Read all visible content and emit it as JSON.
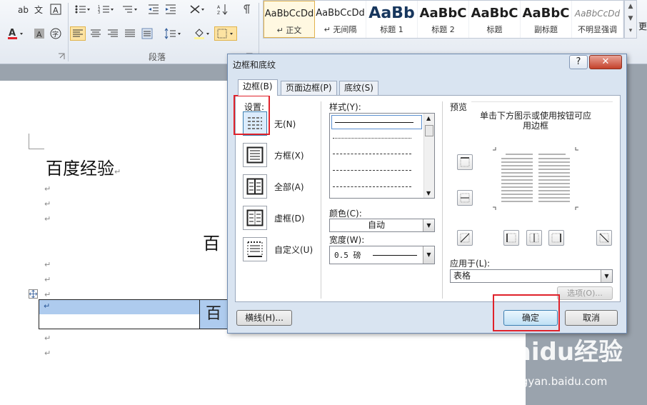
{
  "ribbon": {
    "paragraph_group_label": "段落",
    "styles": [
      {
        "sample": "AaBbCcDd",
        "name": "正文",
        "mark": "↵"
      },
      {
        "sample": "AaBbCcDd",
        "name": "无间隔",
        "mark": "↵"
      },
      {
        "sample": "AaBb",
        "name": "标题 1"
      },
      {
        "sample": "AaBbC",
        "name": "标题 2"
      },
      {
        "sample": "AaBbC",
        "name": "标题"
      },
      {
        "sample": "AaBbC",
        "name": "副标题"
      },
      {
        "sample": "AaBbCcDd",
        "name": "不明显强调"
      }
    ],
    "more_label": "更"
  },
  "document": {
    "heading": "百度经验",
    "centered_text": "百",
    "table_cell_text": "百",
    "paragraph_mark": "↵"
  },
  "dialog": {
    "title": "边框和底纹",
    "help_label": "?",
    "close_label": "✕",
    "tabs": [
      {
        "label": "边框(B)",
        "active": true
      },
      {
        "label": "页面边框(P)",
        "active": false
      },
      {
        "label": "底纹(S)",
        "active": false
      }
    ],
    "settings_label": "设置:",
    "settings": [
      {
        "label": "无(N)",
        "icon": "none-setting-icon",
        "selected": true
      },
      {
        "label": "方框(X)",
        "icon": "box-setting-icon"
      },
      {
        "label": "全部(A)",
        "icon": "all-setting-icon"
      },
      {
        "label": "虚框(D)",
        "icon": "grid-setting-icon"
      },
      {
        "label": "自定义(U)",
        "icon": "custom-setting-icon"
      }
    ],
    "style_label": "样式(Y):",
    "color_label": "颜色(C):",
    "color_value": "自动",
    "width_label": "宽度(W):",
    "width_value": "0.5 磅",
    "preview_label": "预览",
    "preview_hint": "单击下方图示或使用按钮可应用边框",
    "apply_label": "应用于(L):",
    "apply_value": "表格",
    "options_button": "选项(O)...",
    "hline_button": "横线(H)...",
    "ok_button": "确定",
    "cancel_button": "取消"
  },
  "watermark": {
    "brand": "Baidu经验",
    "url": "jingyan.baidu.com"
  },
  "colors": {
    "highlight": "#e0222b",
    "selection": "#aecbee",
    "dialog_bg": "#d9e4f1"
  }
}
